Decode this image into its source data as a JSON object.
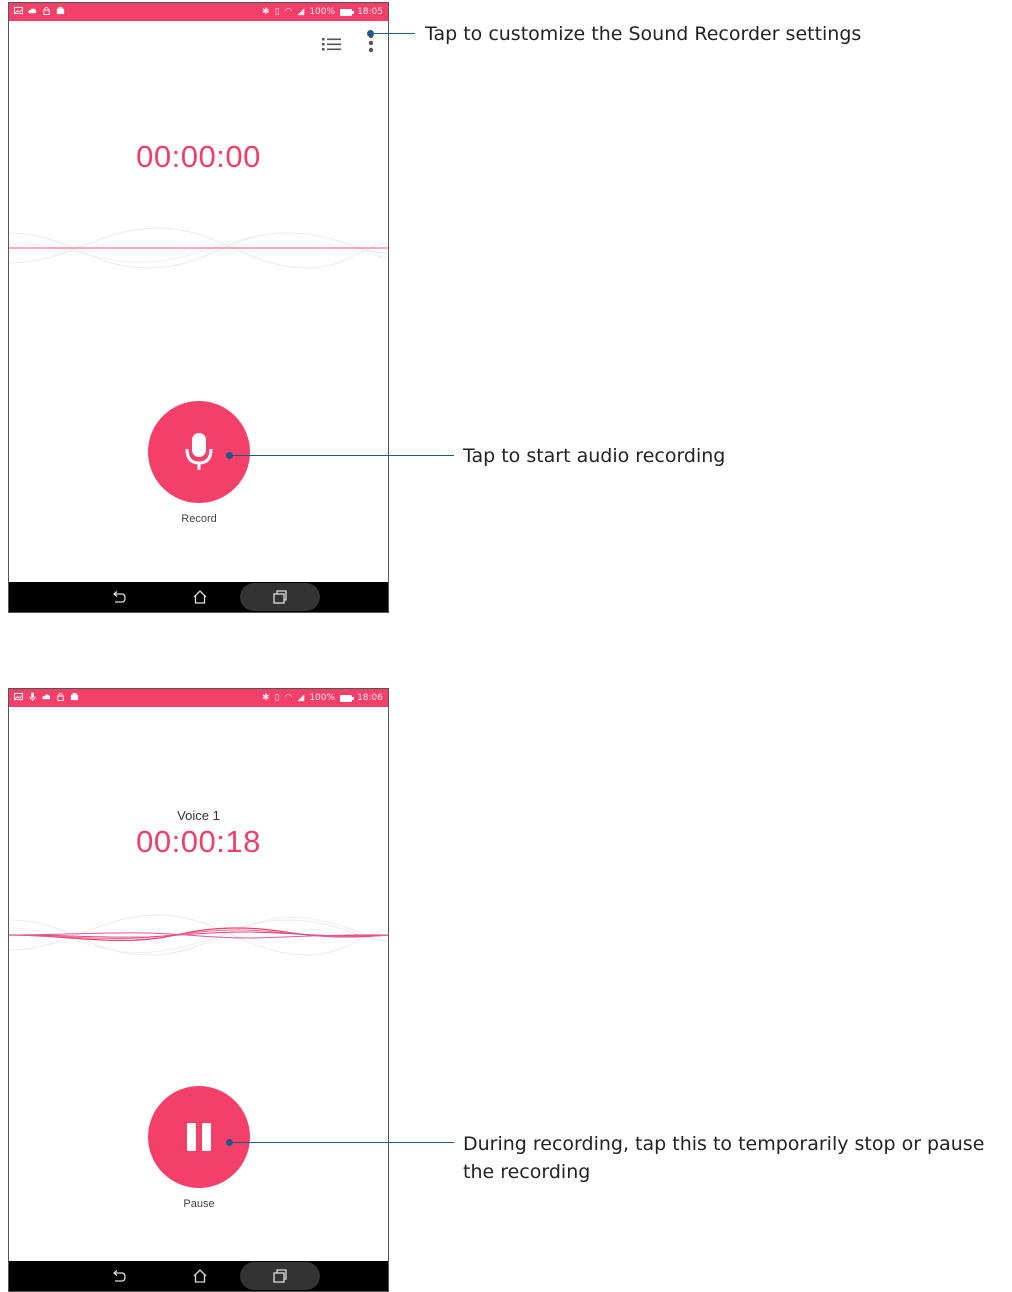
{
  "screen1": {
    "status_time": "18:05",
    "battery": "100%",
    "timer": "00:00:00",
    "button_label": "Record",
    "button_icon": "microphone-icon"
  },
  "screen2": {
    "status_time": "18:06",
    "battery": "100%",
    "recording_name": "Voice 1",
    "timer": "00:00:18",
    "button_label": "Pause",
    "button_icon": "pause-icon"
  },
  "callouts": {
    "settings": "Tap to customize the Sound Recorder settings",
    "record": "Tap to start audio recording",
    "pause_line1": "During recording, tap this to temporarily stop or pause",
    "pause_line2": "the recording"
  },
  "colors": {
    "accent": "#f43f69",
    "callout_line": "#1e5a86"
  }
}
